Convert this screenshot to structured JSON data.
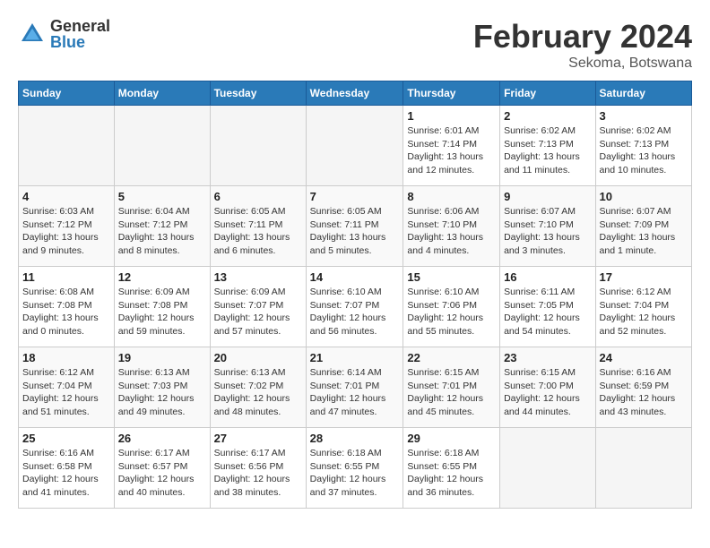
{
  "logo": {
    "general": "General",
    "blue": "Blue"
  },
  "title": {
    "main": "February 2024",
    "sub": "Sekoma, Botswana"
  },
  "headers": [
    "Sunday",
    "Monday",
    "Tuesday",
    "Wednesday",
    "Thursday",
    "Friday",
    "Saturday"
  ],
  "weeks": [
    [
      {
        "num": "",
        "info": ""
      },
      {
        "num": "",
        "info": ""
      },
      {
        "num": "",
        "info": ""
      },
      {
        "num": "",
        "info": ""
      },
      {
        "num": "1",
        "info": "Sunrise: 6:01 AM\nSunset: 7:14 PM\nDaylight: 13 hours\nand 12 minutes."
      },
      {
        "num": "2",
        "info": "Sunrise: 6:02 AM\nSunset: 7:13 PM\nDaylight: 13 hours\nand 11 minutes."
      },
      {
        "num": "3",
        "info": "Sunrise: 6:02 AM\nSunset: 7:13 PM\nDaylight: 13 hours\nand 10 minutes."
      }
    ],
    [
      {
        "num": "4",
        "info": "Sunrise: 6:03 AM\nSunset: 7:12 PM\nDaylight: 13 hours\nand 9 minutes."
      },
      {
        "num": "5",
        "info": "Sunrise: 6:04 AM\nSunset: 7:12 PM\nDaylight: 13 hours\nand 8 minutes."
      },
      {
        "num": "6",
        "info": "Sunrise: 6:05 AM\nSunset: 7:11 PM\nDaylight: 13 hours\nand 6 minutes."
      },
      {
        "num": "7",
        "info": "Sunrise: 6:05 AM\nSunset: 7:11 PM\nDaylight: 13 hours\nand 5 minutes."
      },
      {
        "num": "8",
        "info": "Sunrise: 6:06 AM\nSunset: 7:10 PM\nDaylight: 13 hours\nand 4 minutes."
      },
      {
        "num": "9",
        "info": "Sunrise: 6:07 AM\nSunset: 7:10 PM\nDaylight: 13 hours\nand 3 minutes."
      },
      {
        "num": "10",
        "info": "Sunrise: 6:07 AM\nSunset: 7:09 PM\nDaylight: 13 hours\nand 1 minute."
      }
    ],
    [
      {
        "num": "11",
        "info": "Sunrise: 6:08 AM\nSunset: 7:08 PM\nDaylight: 13 hours\nand 0 minutes."
      },
      {
        "num": "12",
        "info": "Sunrise: 6:09 AM\nSunset: 7:08 PM\nDaylight: 12 hours\nand 59 minutes."
      },
      {
        "num": "13",
        "info": "Sunrise: 6:09 AM\nSunset: 7:07 PM\nDaylight: 12 hours\nand 57 minutes."
      },
      {
        "num": "14",
        "info": "Sunrise: 6:10 AM\nSunset: 7:07 PM\nDaylight: 12 hours\nand 56 minutes."
      },
      {
        "num": "15",
        "info": "Sunrise: 6:10 AM\nSunset: 7:06 PM\nDaylight: 12 hours\nand 55 minutes."
      },
      {
        "num": "16",
        "info": "Sunrise: 6:11 AM\nSunset: 7:05 PM\nDaylight: 12 hours\nand 54 minutes."
      },
      {
        "num": "17",
        "info": "Sunrise: 6:12 AM\nSunset: 7:04 PM\nDaylight: 12 hours\nand 52 minutes."
      }
    ],
    [
      {
        "num": "18",
        "info": "Sunrise: 6:12 AM\nSunset: 7:04 PM\nDaylight: 12 hours\nand 51 minutes."
      },
      {
        "num": "19",
        "info": "Sunrise: 6:13 AM\nSunset: 7:03 PM\nDaylight: 12 hours\nand 49 minutes."
      },
      {
        "num": "20",
        "info": "Sunrise: 6:13 AM\nSunset: 7:02 PM\nDaylight: 12 hours\nand 48 minutes."
      },
      {
        "num": "21",
        "info": "Sunrise: 6:14 AM\nSunset: 7:01 PM\nDaylight: 12 hours\nand 47 minutes."
      },
      {
        "num": "22",
        "info": "Sunrise: 6:15 AM\nSunset: 7:01 PM\nDaylight: 12 hours\nand 45 minutes."
      },
      {
        "num": "23",
        "info": "Sunrise: 6:15 AM\nSunset: 7:00 PM\nDaylight: 12 hours\nand 44 minutes."
      },
      {
        "num": "24",
        "info": "Sunrise: 6:16 AM\nSunset: 6:59 PM\nDaylight: 12 hours\nand 43 minutes."
      }
    ],
    [
      {
        "num": "25",
        "info": "Sunrise: 6:16 AM\nSunset: 6:58 PM\nDaylight: 12 hours\nand 41 minutes."
      },
      {
        "num": "26",
        "info": "Sunrise: 6:17 AM\nSunset: 6:57 PM\nDaylight: 12 hours\nand 40 minutes."
      },
      {
        "num": "27",
        "info": "Sunrise: 6:17 AM\nSunset: 6:56 PM\nDaylight: 12 hours\nand 38 minutes."
      },
      {
        "num": "28",
        "info": "Sunrise: 6:18 AM\nSunset: 6:55 PM\nDaylight: 12 hours\nand 37 minutes."
      },
      {
        "num": "29",
        "info": "Sunrise: 6:18 AM\nSunset: 6:55 PM\nDaylight: 12 hours\nand 36 minutes."
      },
      {
        "num": "",
        "info": ""
      },
      {
        "num": "",
        "info": ""
      }
    ]
  ]
}
